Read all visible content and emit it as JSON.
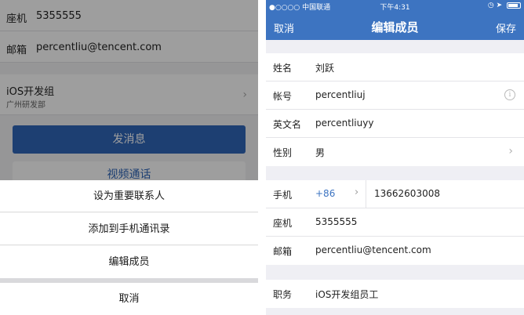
{
  "left": {
    "landline": {
      "label": "座机",
      "value": "5355555"
    },
    "email": {
      "label": "邮箱",
      "value": "percentliu@tencent.com"
    },
    "org": {
      "name": "iOS开发组",
      "sub": "广州研发部"
    },
    "send_message_label": "发消息",
    "video_call_label": "视频通话",
    "action_sheet": {
      "items": [
        "设为重要联系人",
        "添加到手机通讯录",
        "编辑成员"
      ],
      "cancel": "取消"
    }
  },
  "right": {
    "status_bar": {
      "carrier": "●○○○○ 中国联通",
      "time": "下午4:31"
    },
    "nav": {
      "left": "取消",
      "title": "编辑成员",
      "right": "保存"
    },
    "basic_fields": [
      {
        "label": "姓名",
        "value": "刘跃"
      },
      {
        "label": "帐号",
        "value": "percentliuj"
      },
      {
        "label": "英文名",
        "value": "percentliuyy"
      },
      {
        "label": "性别",
        "value": "男"
      }
    ],
    "mobile": {
      "label": "手机",
      "country_code": "+86",
      "number": "13662603008"
    },
    "landline": {
      "label": "座机",
      "value": "5355555"
    },
    "email": {
      "label": "邮箱",
      "value": "percentliu@tencent.com"
    },
    "position": {
      "label": "职务",
      "value": "iOS开发组员工"
    }
  },
  "colors": {
    "brand_blue": "#3d74c1",
    "button_blue": "#2f66b8"
  }
}
